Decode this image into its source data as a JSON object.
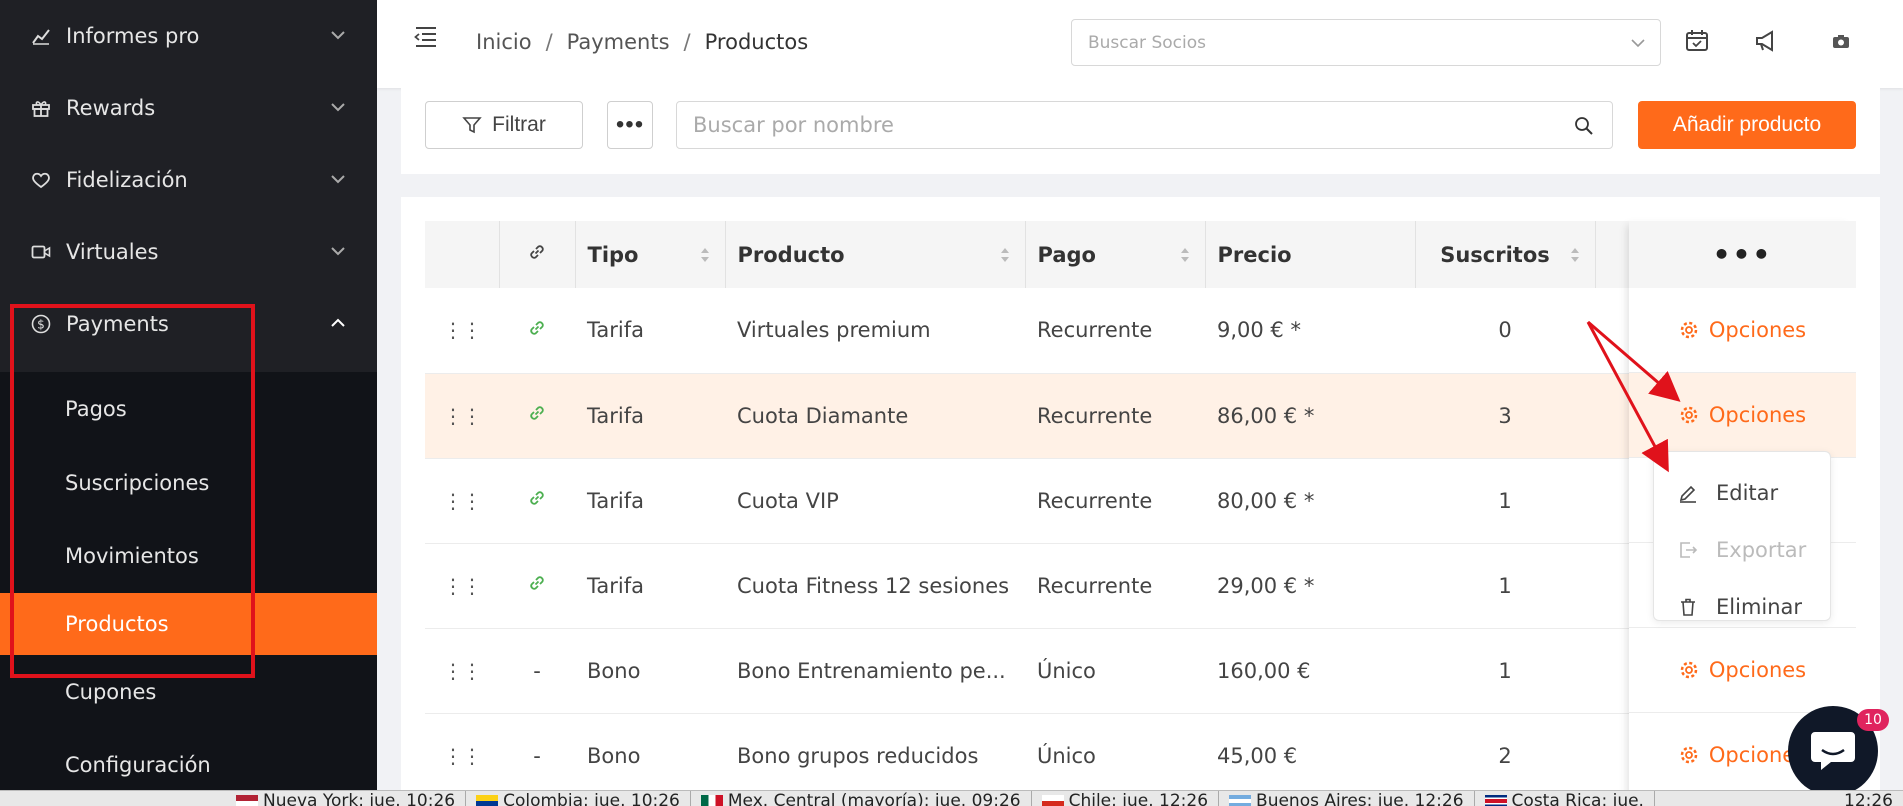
{
  "sidebar": {
    "items": [
      {
        "label": "Informes pro",
        "icon": "chart-line-icon"
      },
      {
        "label": "Rewards",
        "icon": "gift-icon"
      },
      {
        "label": "Fidelización",
        "icon": "heart-icon"
      },
      {
        "label": "Virtuales",
        "icon": "video-icon"
      },
      {
        "label": "Payments",
        "icon": "dollar-circle-icon"
      }
    ],
    "sub_items": [
      "Pagos",
      "Suscripciones",
      "Movimientos",
      "Productos",
      "Cupones",
      "Configuración"
    ],
    "active_sub": "Productos"
  },
  "header": {
    "breadcrumb": [
      "Inicio",
      "Payments",
      "Productos"
    ],
    "member_search_placeholder": "Buscar Socios"
  },
  "toolbar": {
    "filter_label": "Filtrar",
    "more_label": "•••",
    "search_placeholder": "Buscar por nombre",
    "add_label": "Añadir producto"
  },
  "table": {
    "columns": [
      "",
      "",
      "Tipo",
      "Producto",
      "Pago",
      "Precio",
      "Suscritos"
    ],
    "actions_header": "•••",
    "action_label": "Opciones",
    "rows": [
      {
        "link": true,
        "tipo": "Tarifa",
        "producto": "Virtuales premium",
        "pago": "Recurrente",
        "precio": "9,00 € *",
        "suscritos": "0"
      },
      {
        "link": true,
        "tipo": "Tarifa",
        "producto": "Cuota Diamante",
        "pago": "Recurrente",
        "precio": "86,00 € *",
        "suscritos": "3"
      },
      {
        "link": true,
        "tipo": "Tarifa",
        "producto": "Cuota VIP",
        "pago": "Recurrente",
        "precio": "80,00 € *",
        "suscritos": "1"
      },
      {
        "link": true,
        "tipo": "Tarifa",
        "producto": "Cuota Fitness 12 sesiones",
        "pago": "Recurrente",
        "precio": "29,00 € *",
        "suscritos": "1"
      },
      {
        "link": false,
        "link_text": "-",
        "tipo": "Bono",
        "producto": "Bono Entrenamiento pe...",
        "pago": "Único",
        "precio": "160,00 €",
        "suscritos": "1"
      },
      {
        "link": false,
        "link_text": "-",
        "tipo": "Bono",
        "producto": "Bono grupos reducidos",
        "pago": "Único",
        "precio": "45,00 €",
        "suscritos": "2"
      }
    ]
  },
  "menu": {
    "items": [
      {
        "label": "Editar",
        "disabled": false
      },
      {
        "label": "Exportar",
        "disabled": true
      },
      {
        "label": "Eliminar",
        "disabled": false
      }
    ]
  },
  "chat": {
    "badge": "10"
  },
  "taskbar": [
    "Nueva York: jue. 10:26",
    "Colombia: jue. 10:26",
    "Mex. Central (mayoría): jue. 09:26",
    "Chile: jue. 12:26",
    "Buenos Aires: jue. 12:26",
    "Costa Rica: jue.",
    "12:26"
  ],
  "colors": {
    "accent": "#ff6a1a",
    "highlight_row": "#fff1e6",
    "link_green": "#4caf50",
    "annotation_red": "#e0121b"
  }
}
